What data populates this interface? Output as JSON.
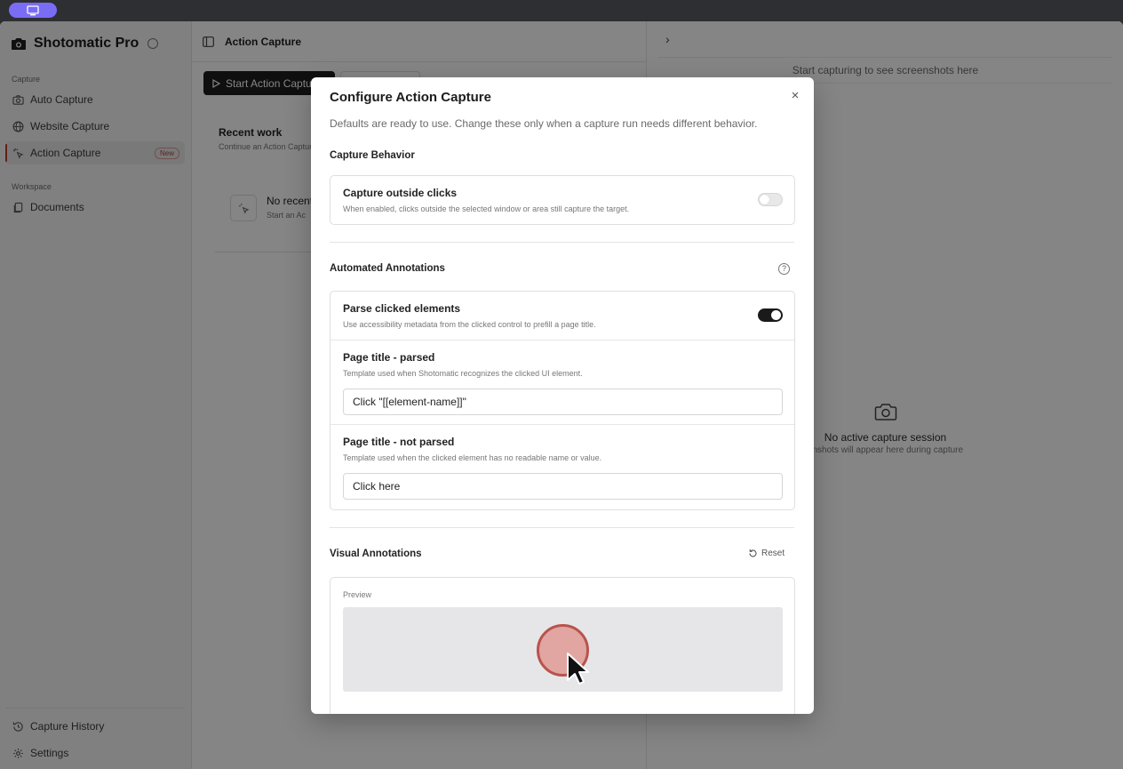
{
  "app": {
    "name": "Shotomatic Pro"
  },
  "sidebar": {
    "capture_section": "Capture",
    "items": [
      {
        "label": "Auto Capture",
        "icon": "camera-icon"
      },
      {
        "label": "Website Capture",
        "icon": "globe-icon"
      },
      {
        "label": "Action Capture",
        "icon": "sparkle-pointer-icon",
        "badge": "New",
        "active": true
      }
    ],
    "workspace_section": "Workspace",
    "workspace_items": [
      {
        "label": "Documents",
        "icon": "documents-icon"
      }
    ],
    "bottom_items": [
      {
        "label": "Capture History",
        "icon": "history-icon"
      },
      {
        "label": "Settings",
        "icon": "gear-icon"
      }
    ]
  },
  "center": {
    "title": "Action Capture",
    "start_button": "Start Action Capture",
    "recent_title": "Recent work",
    "recent_subtitle": "Continue an Action Capture",
    "empty_title": "No recent",
    "empty_subtitle": "Start an Ac"
  },
  "right": {
    "hint": "Start capturing to see screenshots here",
    "empty_title": "No active capture session",
    "empty_subtitle": "enshots will appear here during capture"
  },
  "modal": {
    "title": "Configure Action Capture",
    "close": "×",
    "description": "Defaults are ready to use. Change these only when a capture run needs different behavior.",
    "capture_behavior": {
      "heading": "Capture Behavior",
      "outside_clicks_label": "Capture outside clicks",
      "outside_clicks_desc": "When enabled, clicks outside the selected window or area still capture the target.",
      "outside_clicks_on": false
    },
    "automated": {
      "heading": "Automated Annotations",
      "parse_label": "Parse clicked elements",
      "parse_desc": "Use accessibility metadata from the clicked control to prefill a page title.",
      "parse_on": true,
      "parsed_label": "Page title - parsed",
      "parsed_desc": "Template used when Shotomatic recognizes the clicked UI element.",
      "parsed_value": "Click \"[[element-name]]\"",
      "not_parsed_label": "Page title - not parsed",
      "not_parsed_desc": "Template used when the clicked element has no readable name or value.",
      "not_parsed_value": "Click here"
    },
    "visual": {
      "heading": "Visual Annotations",
      "reset": "Reset",
      "preview_label": "Preview",
      "click_color": "#e1a5a2",
      "click_border": "#b9534d"
    }
  }
}
